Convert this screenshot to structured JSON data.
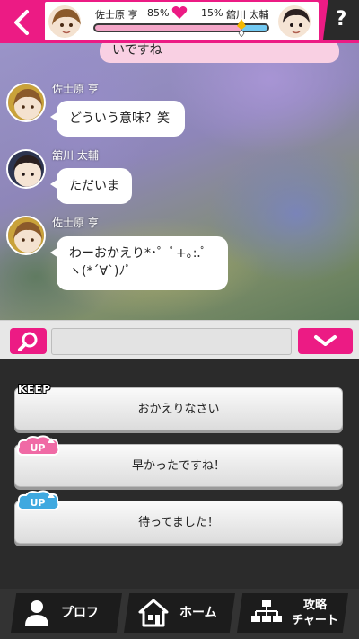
{
  "header": {
    "back_icon": "chevron-left-icon",
    "left_name": "佐士原 亨",
    "left_percent": "85%",
    "right_percent": "15%",
    "right_name": "舘川 太輔",
    "help_label": "?",
    "meter": {
      "left_fraction": 0.85,
      "right_fraction": 0.15
    },
    "colors": {
      "brand": "#ec1b84",
      "left_bar": "#f3a6c8",
      "right_bar": "#72c9f2"
    }
  },
  "chat": {
    "messages": [
      {
        "sender": "",
        "text": "いですね",
        "self": true
      },
      {
        "sender": "佐士原 亨",
        "text": "どういう意味？笑"
      },
      {
        "sender": "舘川 太輔",
        "text": "ただいま"
      },
      {
        "sender": "佐士原 亨",
        "line1": "わーおかえり*･゜ﾟ+｡:.ﾟ",
        "line2": "ヽ(*´∀`)ﾉﾟ"
      }
    ]
  },
  "search": {
    "icon": "search-icon",
    "value": "",
    "expand_icon": "chevron-down-icon"
  },
  "choices": {
    "keep_label": "KEEP",
    "up_label": "UP",
    "items": [
      {
        "label": "おかえりなさい",
        "tag": "KEEP"
      },
      {
        "label": "早かったですね！",
        "tag": "UP",
        "tag_color": "#f06aa5"
      },
      {
        "label": "待ってました！",
        "tag": "UP",
        "tag_color": "#3fa9e0"
      }
    ]
  },
  "nav": {
    "profile": {
      "label": "プロフ",
      "icon": "person-icon"
    },
    "home": {
      "label": "ホーム",
      "icon": "house-icon"
    },
    "chart": {
      "label1": "攻略",
      "label2": "チャート",
      "icon": "flowchart-icon"
    }
  }
}
